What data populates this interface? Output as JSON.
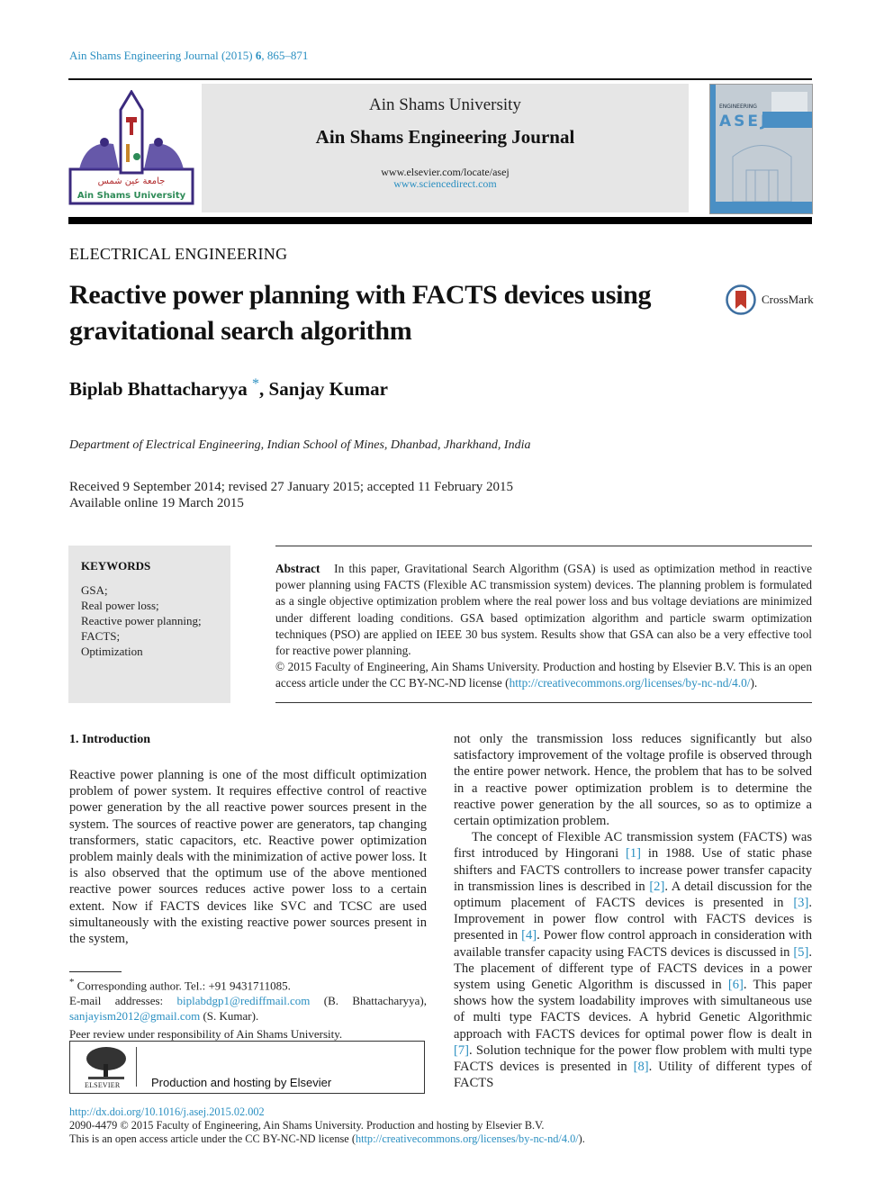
{
  "header": {
    "citation_prefix": "Ain Shams Engineering Journal (2015) ",
    "citation_volume": "6",
    "citation_pages": ", 865–871",
    "university": "Ain Shams University",
    "journal": "Ain Shams Engineering Journal",
    "url_locate": "www.elsevier.com/locate/asej",
    "url_sciencedirect": "www.sciencedirect.com",
    "logo_text": "Ain Shams University",
    "cover_acronym": "ASEJ",
    "cover_label": "ENGINEERING"
  },
  "article": {
    "section": "ELECTRICAL ENGINEERING",
    "title": "Reactive power planning with FACTS devices using gravitational search algorithm",
    "crossmark_label": "CrossMark",
    "authors_main": "Biplab Bhattacharyya ",
    "author_mark": "*",
    "authors_rest": ", Sanjay Kumar",
    "affiliation": "Department of Electrical Engineering, Indian School of Mines, Dhanbad, Jharkhand, India",
    "received_line": "Received 9 September 2014; revised 27 January 2015; accepted 11 February 2015",
    "online_line": "Available online 19 March 2015"
  },
  "keywords": {
    "heading": "KEYWORDS",
    "items": [
      "GSA;",
      "Real power loss;",
      "Reactive power planning;",
      "FACTS;",
      "Optimization"
    ]
  },
  "abstract": {
    "label": "Abstract",
    "text": "In this paper, Gravitational Search Algorithm (GSA) is used as optimization method in reactive power planning using FACTS (Flexible AC transmission system) devices. The planning problem is formulated as a single objective optimization problem where the real power loss and bus voltage deviations are minimized under different loading conditions. GSA based optimization algorithm and particle swarm optimization techniques (PSO) are applied on IEEE 30 bus system. Results show that GSA can also be a very effective tool for reactive power planning.",
    "copyright": "© 2015 Faculty of Engineering, Ain Shams University. Production and hosting by Elsevier B.V.  This is an open access article under the CC BY-NC-ND license (",
    "license_url": "http://creativecommons.org/licenses/by-nc-nd/4.0/",
    "copyright_end": ")."
  },
  "intro": {
    "heading": "1. Introduction",
    "left_paragraph": "Reactive power planning is one of the most difficult optimization problem of power system. It requires effective control of reactive power generation by the all reactive power sources present in the system. The sources of reactive power are generators, tap changing transformers, static capacitors, etc. Reactive power optimization problem mainly deals with the minimization of active power loss. It is also observed that the optimum use of the above mentioned reactive power sources reduces active power loss to a certain extent. Now if FACTS devices like SVC and TCSC are used simultaneously with the existing reactive power sources present in the system,",
    "right_paragraph_1": "not only the transmission loss reduces significantly but also satisfactory improvement of the voltage profile is observed through the entire power network. Hence, the problem that has to be solved in a reactive power optimization problem is to determine the reactive power generation by the all sources, so as to optimize a certain optimization problem.",
    "p2_segments": [
      "The concept of Flexible AC transmission system (FACTS) was first introduced by Hingorani ",
      " in 1988. Use of static phase shifters and FACTS controllers to increase power transfer capacity in transmission lines is described in ",
      ". A detail discussion for the optimum placement of FACTS devices is presented in ",
      ". Improvement in power flow control with FACTS devices is presented in ",
      ". Power flow control approach in consideration with available transfer capacity using FACTS devices is discussed in ",
      ". The placement of different type of FACTS devices in a power system using Genetic Algorithm is discussed in ",
      ". This paper shows how the system loadability improves with simultaneous use of multi type FACTS devices. A hybrid Genetic Algorithmic approach with FACTS devices for optimal power flow is dealt in ",
      ". Solution technique for the power flow problem with multi type FACTS devices is presented in ",
      ". Utility of different types of FACTS"
    ],
    "refs": [
      "[1]",
      "[2]",
      "[3]",
      "[4]",
      "[5]",
      "[6]",
      "[7]",
      "[8]"
    ]
  },
  "footnotes": {
    "star": "*",
    "corresponding": " Corresponding author. Tel.: +91 9431711085.",
    "email_label": "E-mail addresses: ",
    "email1": "biplabdgp1@rediffmail.com",
    "email1_name": " (B. Bhattacharyya),",
    "email2": "sanjayism2012@gmail.com",
    "email2_name": " (S. Kumar).",
    "peer_review": "Peer review under responsibility of Ain Shams University.",
    "elsevier_label": "ELSEVIER",
    "production": "Production and hosting by Elsevier"
  },
  "bottom": {
    "doi": "http://dx.doi.org/10.1016/j.asej.2015.02.002",
    "issn_line": "2090-4479 © 2015 Faculty of Engineering, Ain Shams University. Production and hosting by Elsevier B.V.",
    "license_prefix": "This is an open access article under the CC BY-NC-ND license (",
    "license_url": "http://creativecommons.org/licenses/by-nc-nd/4.0/",
    "license_end": ")."
  },
  "colors": {
    "link": "#2a8fc1",
    "banner_bg": "#e6e6e6",
    "cover_blue": "#4a8fc4",
    "logo_purple": "#3b2a7e",
    "crossmark_red": "#c0392b"
  }
}
